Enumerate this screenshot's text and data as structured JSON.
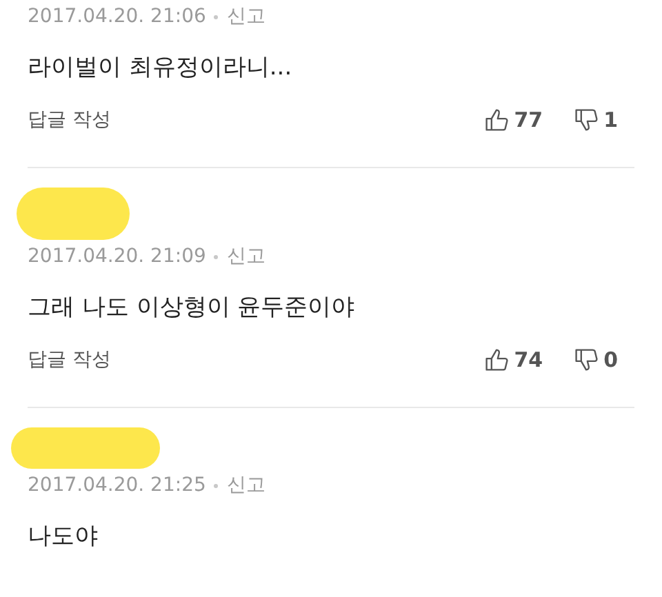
{
  "comments": [
    {
      "redacted": false,
      "date": "2017.04.20. 21:06",
      "report": "신고",
      "text": "라이벌이 최유정이라니...",
      "reply": "답글 작성",
      "likes": "77",
      "dislikes": "1"
    },
    {
      "redacted": true,
      "date": "2017.04.20. 21:09",
      "report": "신고",
      "text": "그래 나도 이상형이 윤두준이야",
      "reply": "답글 작성",
      "likes": "74",
      "dislikes": "0"
    },
    {
      "redacted": true,
      "date": "2017.04.20. 21:25",
      "report": "신고",
      "text": "나도야"
    }
  ]
}
